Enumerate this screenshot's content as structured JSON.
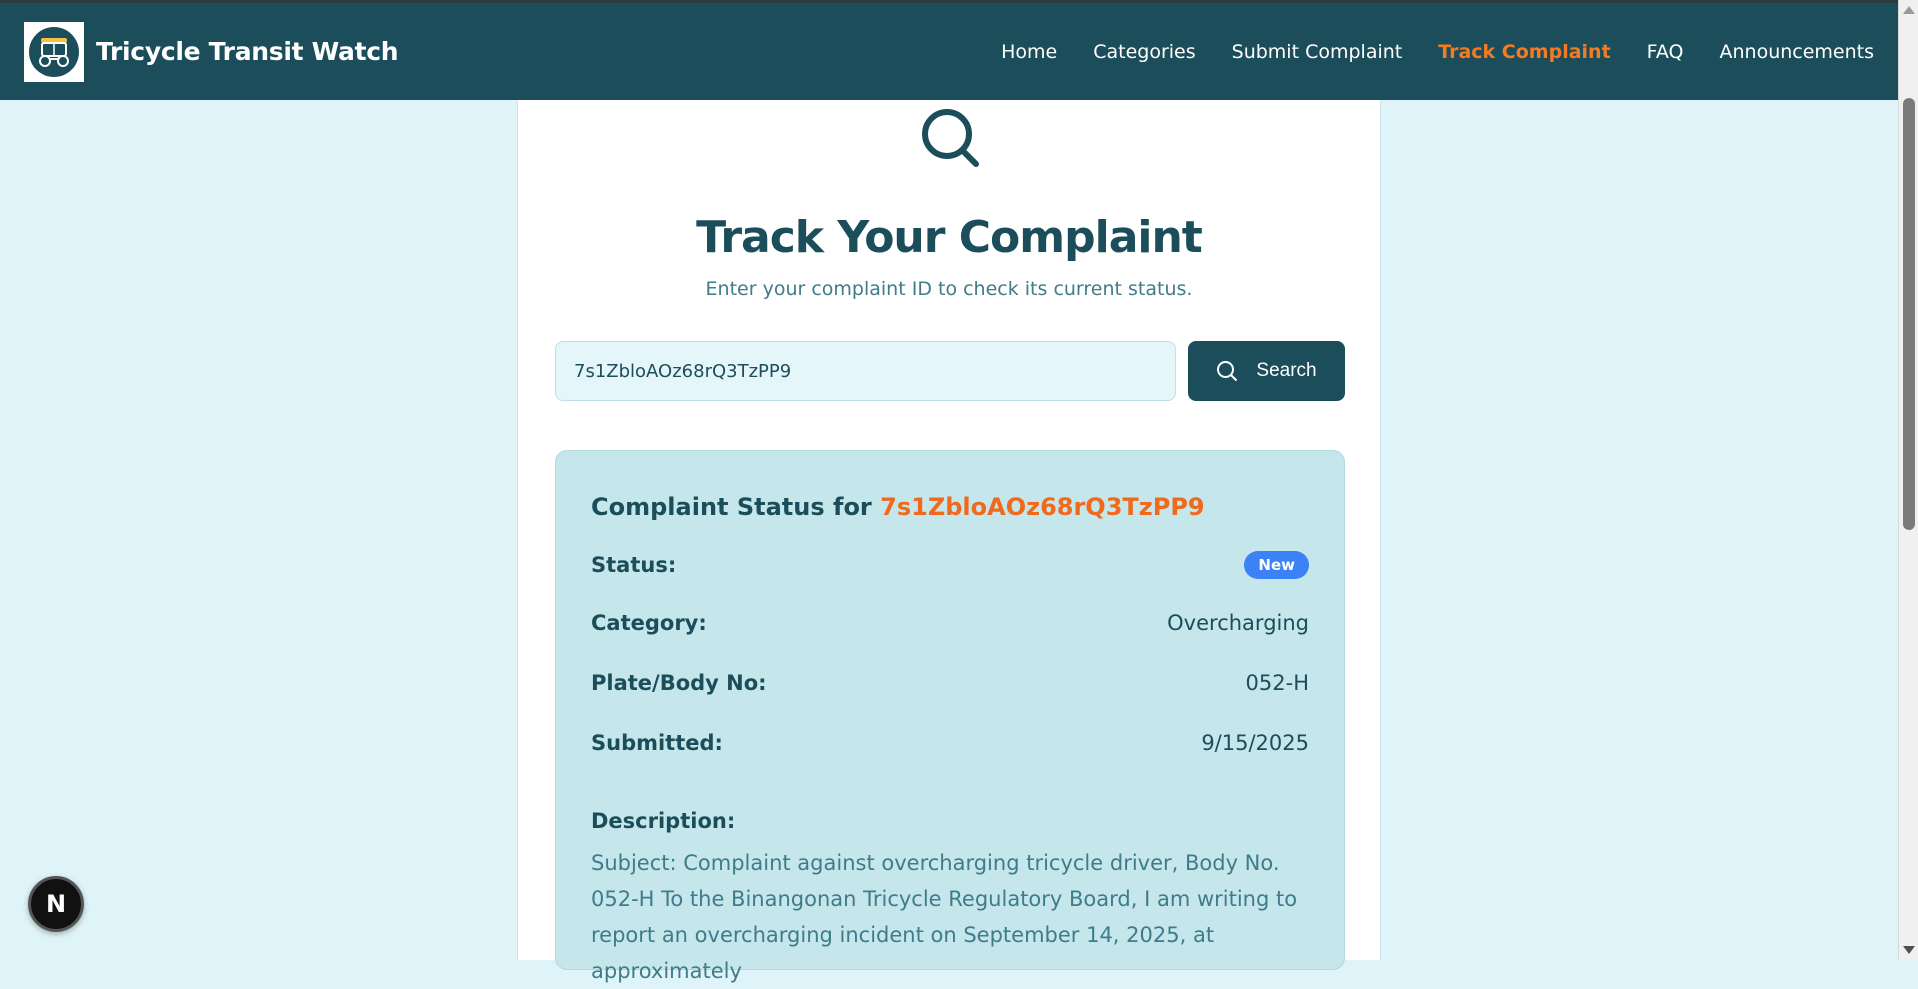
{
  "header": {
    "brand_title": "Tricycle Transit Watch",
    "logo_icon": "tricycle-logo-icon",
    "nav": [
      {
        "label": "Home",
        "active": false
      },
      {
        "label": "Categories",
        "active": false
      },
      {
        "label": "Submit Complaint",
        "active": false
      },
      {
        "label": "Track Complaint",
        "active": true
      },
      {
        "label": "FAQ",
        "active": false
      },
      {
        "label": "Announcements",
        "active": false
      }
    ],
    "accent_color": "#f57a24",
    "bg_color": "#1b4e5a"
  },
  "tracker": {
    "icon": "search-icon",
    "title": "Track Your Complaint",
    "subtitle": "Enter your complaint ID to check its current status.",
    "input_value": "7s1ZbloAOz68rQ3TzPP9",
    "search_label": "Search"
  },
  "result": {
    "title_prefix": "Complaint Status for",
    "complaint_id": "7s1ZbloAOz68rQ3TzPP9",
    "status_label": "Status:",
    "status_value": "New",
    "status_color": "#3b82f6",
    "category_label": "Category:",
    "category_value": "Overcharging",
    "plate_label": "Plate/Body No:",
    "plate_value": "052-H",
    "submitted_label": "Submitted:",
    "submitted_value": "9/15/2025",
    "description_label": "Description:",
    "description_text": "Subject: Complaint against overcharging tricycle driver, Body No. 052-H To the Binangonan Tricycle Regulatory Board, I am writing to report an overcharging incident on September 14, 2025, at approximately"
  },
  "fab": {
    "label": "N"
  }
}
